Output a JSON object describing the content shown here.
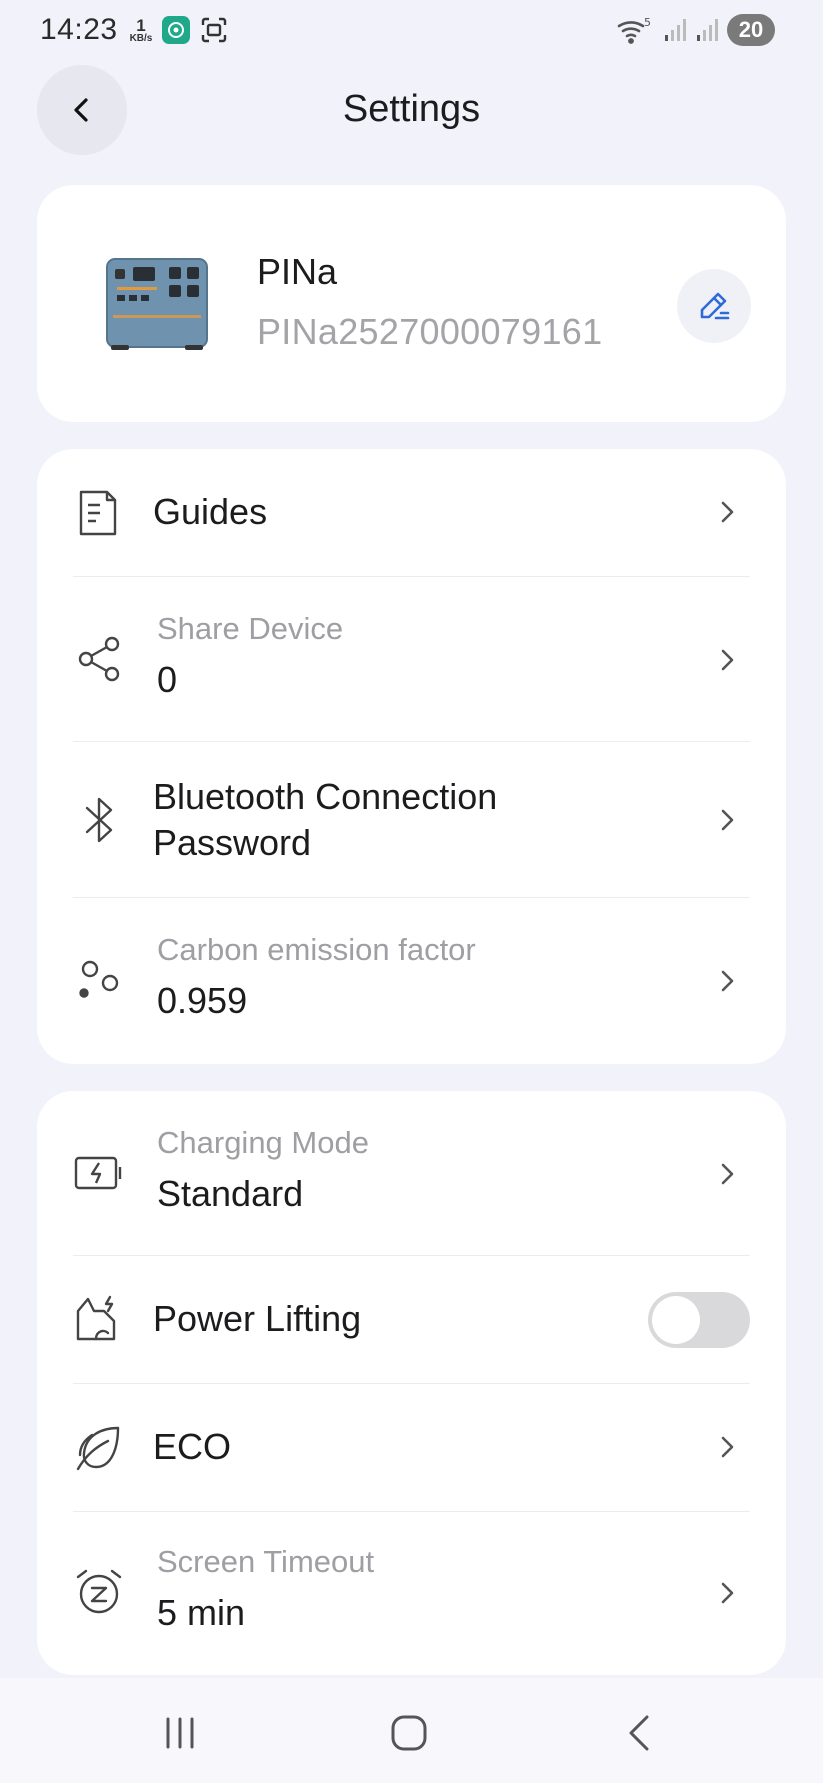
{
  "status_bar": {
    "time": "14:23",
    "net_speed_value": "1",
    "net_speed_unit": "KB/s",
    "wifi_badge": "5",
    "battery": "20"
  },
  "header": {
    "title": "Settings",
    "back_icon": "chevron-left-icon"
  },
  "device": {
    "name": "PINa",
    "serial": "PINa2527000079161",
    "image_icon": "power-station-icon",
    "edit_icon": "edit-pencil-icon",
    "accent_color": "#2F6BD8"
  },
  "section1": {
    "guides": {
      "label": "Guides",
      "icon": "document-icon"
    },
    "share_device": {
      "label": "Share Device",
      "value": "0",
      "icon": "share-icon"
    },
    "bluetooth": {
      "label_line1": "Bluetooth Connection",
      "label_line2": "Password",
      "icon": "bluetooth-icon"
    },
    "carbon": {
      "label": "Carbon emission factor",
      "value": "0.959",
      "icon": "carbon-dots-icon"
    }
  },
  "section2": {
    "charging_mode": {
      "label": "Charging Mode",
      "value": "Standard",
      "icon": "battery-charging-icon"
    },
    "power_lifting": {
      "label": "Power Lifting",
      "enabled": false,
      "icon": "power-lifting-icon"
    },
    "eco": {
      "label": "ECO",
      "icon": "leaf-icon"
    },
    "screen_timeout": {
      "label": "Screen Timeout",
      "value": "5 min",
      "icon": "alarm-sleep-icon"
    }
  },
  "nav": {
    "recents_icon": "recents-icon",
    "home_icon": "home-icon",
    "back_icon": "back-icon"
  }
}
